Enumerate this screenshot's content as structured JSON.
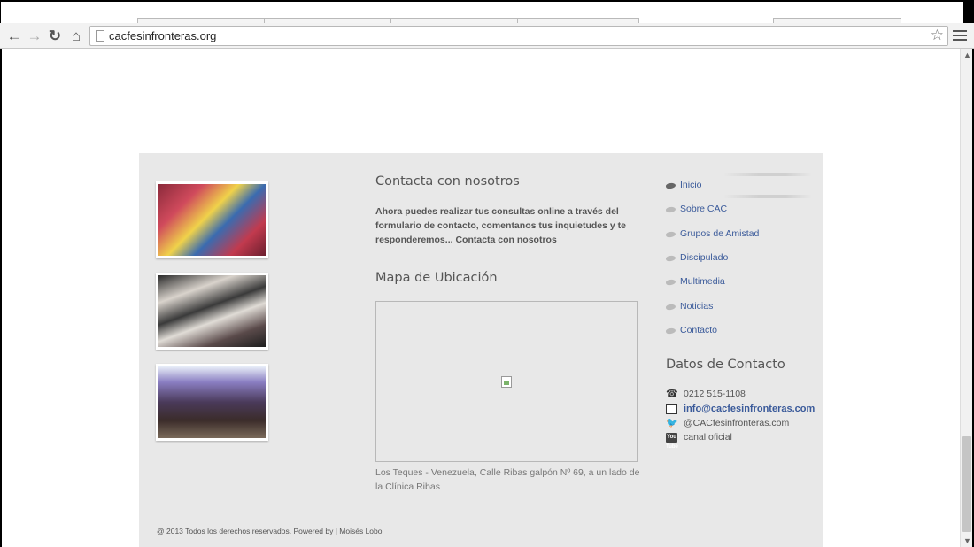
{
  "browser": {
    "url": "cacfesinfronteras.org",
    "back_icon": "←",
    "forward_icon": "→",
    "reload_icon": "↻",
    "home_icon": "⌂",
    "star_icon": "☆"
  },
  "contact": {
    "title": "Contacta con nosotros",
    "text": "Ahora puedes realizar tus consultas online a través del formulario de contacto, comentanos tus inquietudes y te responderemos... Contacta con nosotros"
  },
  "map": {
    "title": "Mapa de Ubicación",
    "address": "Los Teques - Venezuela, Calle Ribas galpón Nº 69, a un lado de la Clínica Ribas"
  },
  "menu": [
    {
      "label": "Inicio"
    },
    {
      "label": "Sobre CAC"
    },
    {
      "label": "Grupos de Amistad"
    },
    {
      "label": "Discipulado"
    },
    {
      "label": "Multimedia"
    },
    {
      "label": "Noticias"
    },
    {
      "label": "Contacto"
    }
  ],
  "contact_data": {
    "title": "Datos de Contacto",
    "phone": "0212 515-1108",
    "email": "info@cacfesinfronteras.com",
    "twitter": "@CACfesinfronteras.com",
    "youtube": "canal oficial",
    "youtube_icon_text": "You Tube"
  },
  "footer": {
    "copyright": "@ 2013 Todos los derechos reservados. Powered by | Moisés Lobo"
  }
}
